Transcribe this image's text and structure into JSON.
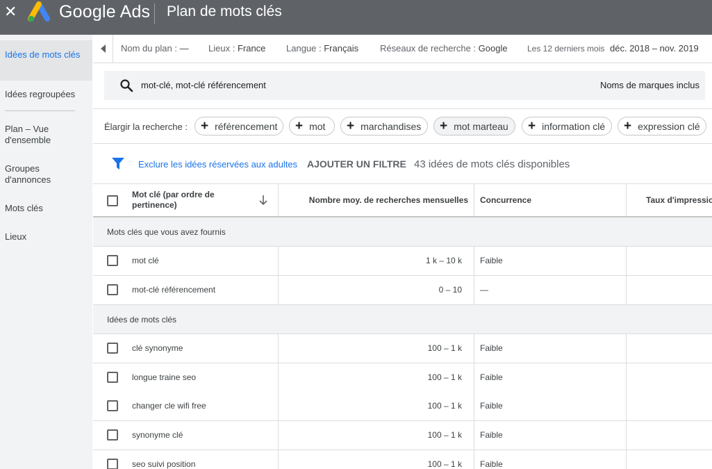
{
  "app": {
    "brand": "Google Ads",
    "page_title": "Plan de mots clés"
  },
  "sidebar": {
    "items": [
      {
        "label": "Idées de mots clés",
        "active": true
      },
      {
        "label": "Idées regroupées"
      },
      {
        "label": "Plan – Vue d'ensemble"
      },
      {
        "label": "Groupes d'annonces"
      },
      {
        "label": "Mots clés"
      },
      {
        "label": "Lieux"
      }
    ]
  },
  "plan": {
    "name_label": "Nom du plan :",
    "name_value": "—",
    "locations_label": "Lieux :",
    "locations_value": "France",
    "language_label": "Langue :",
    "language_value": "Français",
    "networks_label": "Réseaux de recherche :",
    "networks_value": "Google",
    "period_label": "Les 12 derniers mois",
    "period_value": "déc. 2018 – nov. 2019"
  },
  "search": {
    "query": "mot-clé, mot-clé référencement",
    "brand_toggle": "Noms de marques inclus"
  },
  "broaden": {
    "label": "Élargir la recherche :",
    "chips": [
      {
        "label": "référencement"
      },
      {
        "label": "mot"
      },
      {
        "label": "marchandises"
      },
      {
        "label": "mot marteau",
        "selected": true
      },
      {
        "label": "information clé"
      },
      {
        "label": "expression clé"
      }
    ]
  },
  "filters": {
    "exclude_adult": "Exclure les idées réservées aux adultes",
    "add_filter": "AJOUTER UN FILTRE",
    "count_text": "43 idées de mots clés disponibles"
  },
  "table": {
    "columns": {
      "keyword": "Mot clé (par ordre de pertinence)",
      "volume": "Nombre moy. de recherches mensuelles",
      "competition": "Concurrence",
      "impression_share": "Taux d'impression"
    },
    "groups": [
      {
        "title": "Mots clés que vous avez fournis",
        "rows": [
          {
            "keyword": "mot clé",
            "volume": "1 k – 10 k",
            "competition": "Faible"
          },
          {
            "keyword": "mot-clé référencement",
            "volume": "0 – 10",
            "competition": "—"
          }
        ]
      },
      {
        "title": "Idées de mots clés",
        "rows": [
          {
            "keyword": "clé synonyme",
            "volume": "100 – 1 k",
            "competition": "Faible"
          },
          {
            "keyword": "longue traine seo",
            "volume": "100 – 1 k",
            "competition": "Faible"
          },
          {
            "keyword": "changer cle wifi free",
            "volume": "100 – 1 k",
            "competition": "Faible"
          },
          {
            "keyword": "synonyme clé",
            "volume": "100 – 1 k",
            "competition": "Faible"
          },
          {
            "keyword": "seo suivi position",
            "volume": "100 – 1 k",
            "competition": "Faible"
          }
        ]
      }
    ]
  },
  "colors": {
    "app_bar": "#5f6368",
    "accent": "#1a73e8",
    "sidebar_bg": "#f1f3f4"
  }
}
